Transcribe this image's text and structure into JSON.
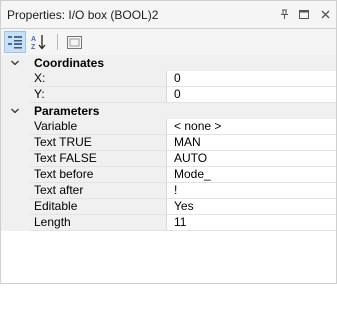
{
  "window": {
    "title": "Properties: I/O box (BOOL)2"
  },
  "toolbar": {
    "categorized_icon": "categorized-view-icon",
    "alphabetical_icon": "sort-alphabetical-icon",
    "property_pages_icon": "property-pages-icon"
  },
  "categories": [
    {
      "label": "Coordinates",
      "rows": [
        {
          "name": "X:",
          "value": "0"
        },
        {
          "name": "Y:",
          "value": "0"
        }
      ]
    },
    {
      "label": "Parameters",
      "rows": [
        {
          "name": "Variable",
          "value": "< none >"
        },
        {
          "name": "Text TRUE",
          "value": "MAN"
        },
        {
          "name": "Text FALSE",
          "value": "AUTO"
        },
        {
          "name": "Text before",
          "value": "Mode_"
        },
        {
          "name": "Text after",
          "value": "!"
        },
        {
          "name": "Editable",
          "value": "Yes"
        },
        {
          "name": "Length",
          "value": "11"
        }
      ]
    }
  ],
  "colors": {
    "accent_active": "#c9e0f7",
    "category_bg": "#f0f0f0"
  }
}
